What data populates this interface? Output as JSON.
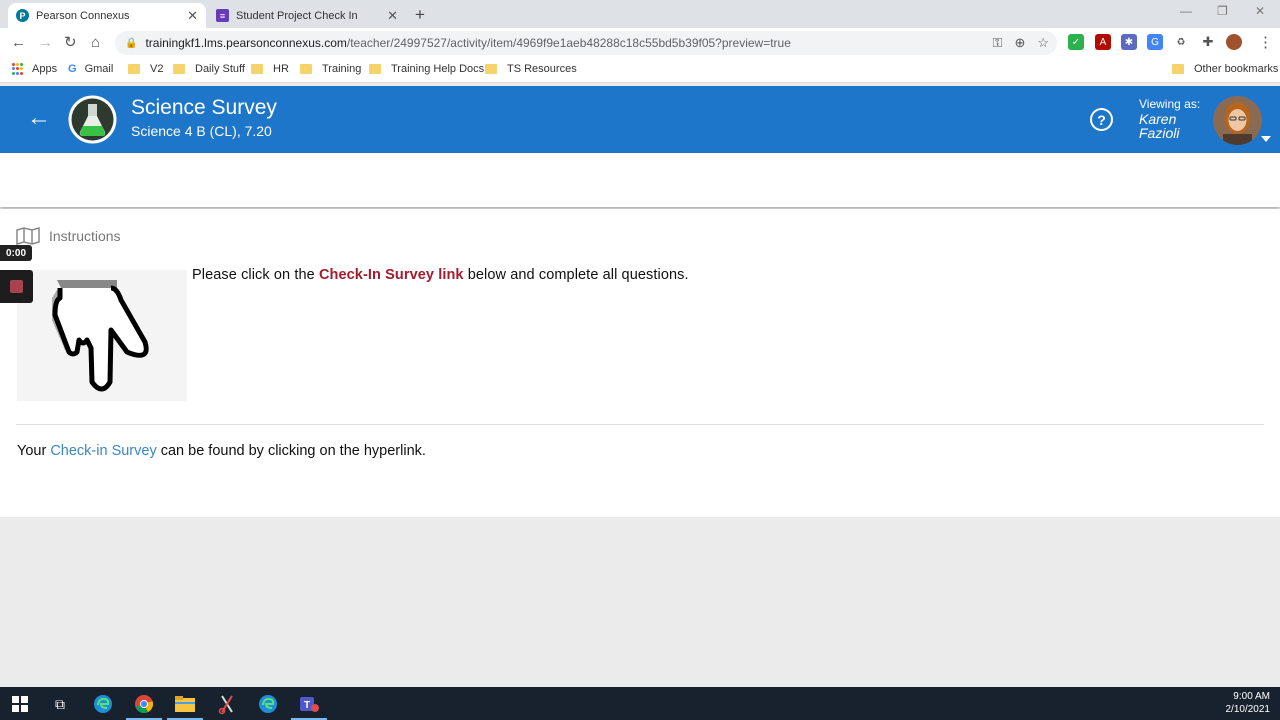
{
  "browser": {
    "tabs": [
      {
        "title": "Pearson Connexus",
        "favicon": "pearson-icon",
        "active": true
      },
      {
        "title": "Student Project Check In",
        "favicon": "forms-icon",
        "active": false
      }
    ],
    "url_host": "trainingkf1.lms.pearsonconnexus.com",
    "url_path": "/teacher/24997527/activity/item/4969f9e1aeb48288c18c55bd5b39f05?preview=true",
    "bookmarks": [
      "Apps",
      "Gmail",
      "V2",
      "Daily Stuff",
      "HR",
      "Training",
      "Training Help Docs",
      "TS Resources"
    ],
    "other_bookmarks": "Other bookmarks"
  },
  "header": {
    "title": "Science Survey",
    "subtitle": "Science 4 B (CL), 7.20",
    "viewing_label": "Viewing as:",
    "viewing_name": "Karen Fazioli",
    "accent_color": "#1e76cb"
  },
  "content": {
    "section_label": "Instructions",
    "instruction_pre": "Please click on the ",
    "instruction_link": "Check-In Survey link",
    "instruction_post": " below and complete all questions.",
    "survey_pre": "Your ",
    "survey_link": "Check-in Survey",
    "survey_post": " can be found by clicking on the hyperlink.",
    "link_color": "#a31b2d"
  },
  "recorder": {
    "time": "0:00"
  },
  "taskbar": {
    "time": "9:00 AM",
    "date": "2/10/2021"
  }
}
